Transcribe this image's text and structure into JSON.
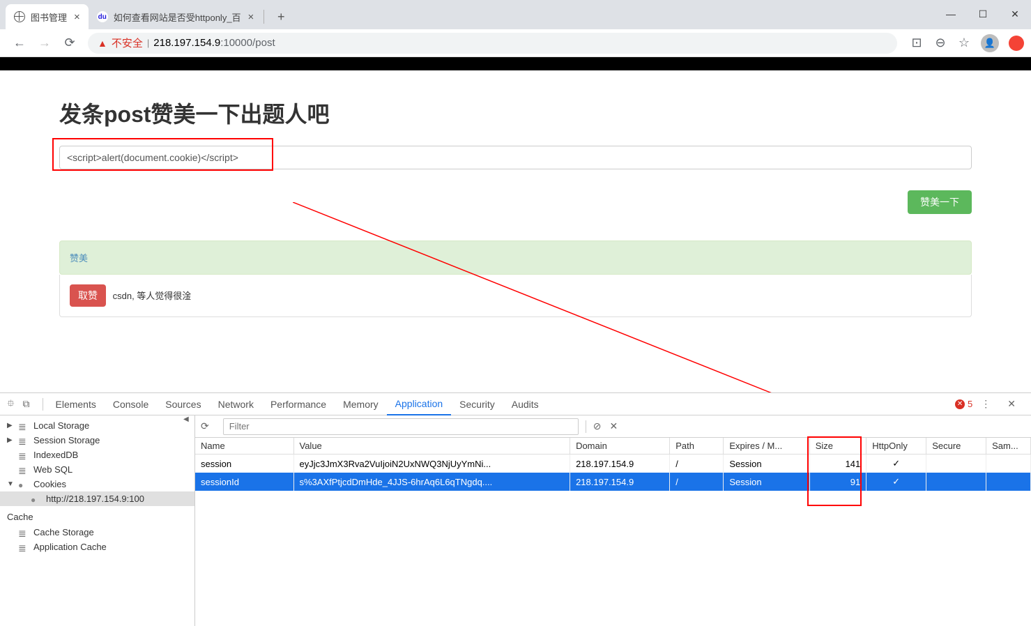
{
  "window": {
    "minimize": "—",
    "maximize": "☐",
    "close": "✕"
  },
  "tabs": [
    {
      "title": "图书管理",
      "icon": "globe",
      "active": true
    },
    {
      "title": "如何查看网站是否受httponly_百",
      "icon": "baidu",
      "active": false
    }
  ],
  "url": {
    "unsafe_label": "不安全",
    "host": "218.197.154.9",
    "port": ":10000",
    "path": "/post"
  },
  "page": {
    "title": "发条post赞美一下出题人吧",
    "input_value": "<script>alert(document.cookie)</script>",
    "submit": "赞美一下",
    "alert_text": "赞美",
    "cancel": "取赞",
    "panel_text": "csdn, 等人觉得很淦"
  },
  "devtools": {
    "tabs": [
      "Elements",
      "Console",
      "Sources",
      "Network",
      "Performance",
      "Memory",
      "Application",
      "Security",
      "Audits"
    ],
    "active_tab": "Application",
    "error_count": "5",
    "sidebar": {
      "local_storage": "Local Storage",
      "session_storage": "Session Storage",
      "indexeddb": "IndexedDB",
      "websql": "Web SQL",
      "cookies": "Cookies",
      "cookie_url": "http://218.197.154.9:100",
      "cache_heading": "Cache",
      "cache_storage": "Cache Storage",
      "app_cache": "Application Cache"
    },
    "filter_placeholder": "Filter",
    "columns": [
      "Name",
      "Value",
      "Domain",
      "Path",
      "Expires / M...",
      "Size",
      "HttpOnly",
      "Secure",
      "Sam..."
    ],
    "rows": [
      {
        "name": "session",
        "value": "eyJjc3JmX3Rva2VuIjoiN2UxNWQ3NjUyYmNi...",
        "domain": "218.197.154.9",
        "path": "/",
        "expires": "Session",
        "size": "141",
        "httponly": "✓",
        "secure": "",
        "same": "",
        "selected": false
      },
      {
        "name": "sessionId",
        "value": "s%3AXfPtjcdDmHde_4JJS-6hrAq6L6qTNgdq....",
        "domain": "218.197.154.9",
        "path": "/",
        "expires": "Session",
        "size": "91",
        "httponly": "✓",
        "secure": "",
        "same": "",
        "selected": true
      }
    ]
  }
}
